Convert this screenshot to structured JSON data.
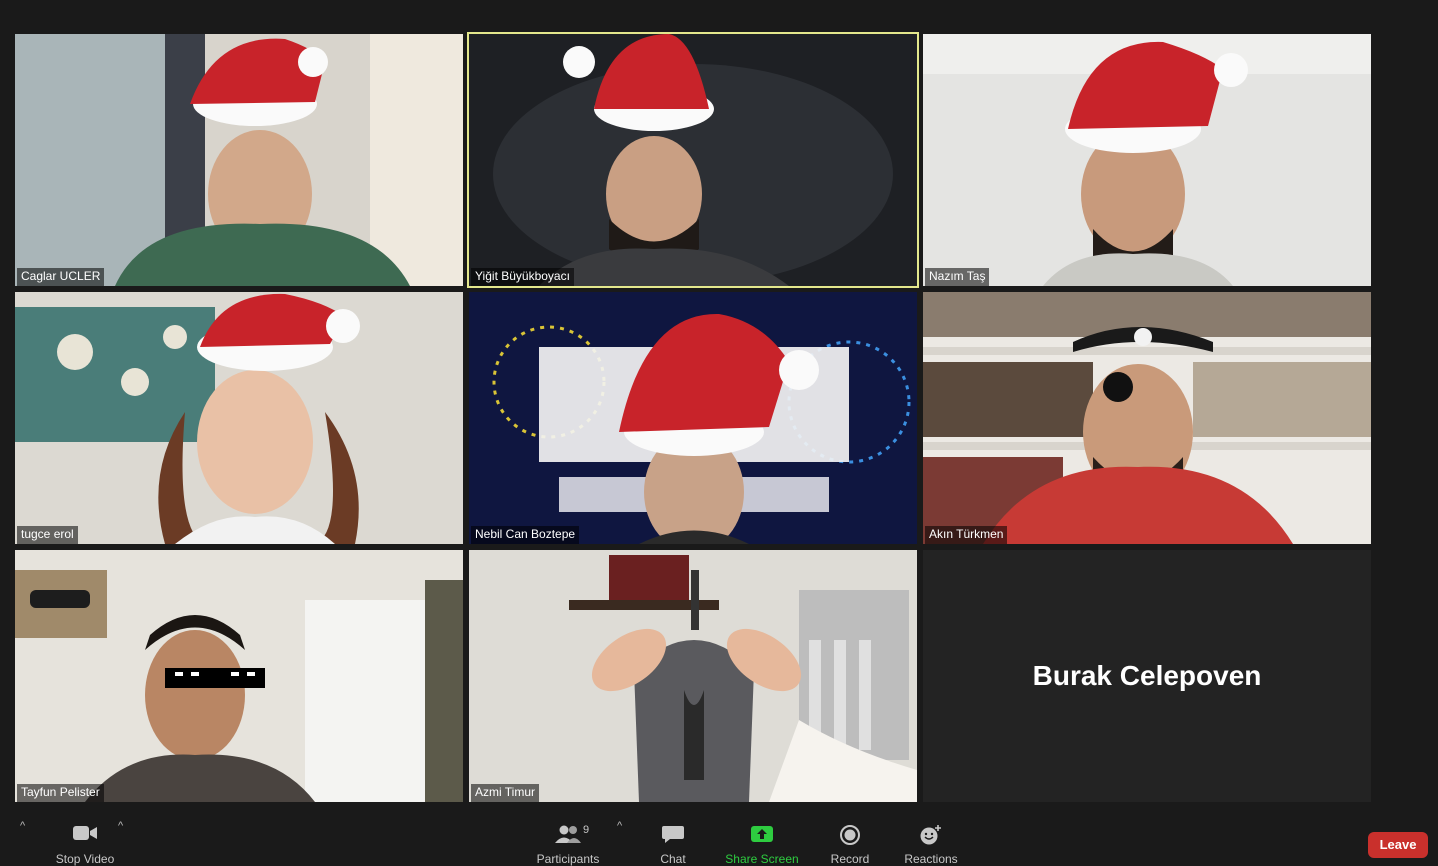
{
  "participants": [
    {
      "name": "Caglar UCLER"
    },
    {
      "name": "Yiğit Büyükboyacı"
    },
    {
      "name": "Nazım Taş"
    },
    {
      "name": "tugce erol"
    },
    {
      "name": "Nebil Can Boztepe"
    },
    {
      "name": "Akın Türkmen"
    },
    {
      "name": "Tayfun Pelister"
    },
    {
      "name": "Azmi Timur"
    },
    {
      "name": "Burak Celepoven"
    }
  ],
  "toolbar": {
    "stop_video": "Stop Video",
    "participants": "Participants",
    "participants_count": "9",
    "chat": "Chat",
    "share_screen": "Share Screen",
    "record": "Record",
    "reactions": "Reactions",
    "leave": "Leave",
    "caret": "^"
  },
  "colors": {
    "active_speaker_border": "#e3e78c",
    "leave_button": "#c9302c",
    "share_screen": "#2ecc40"
  }
}
